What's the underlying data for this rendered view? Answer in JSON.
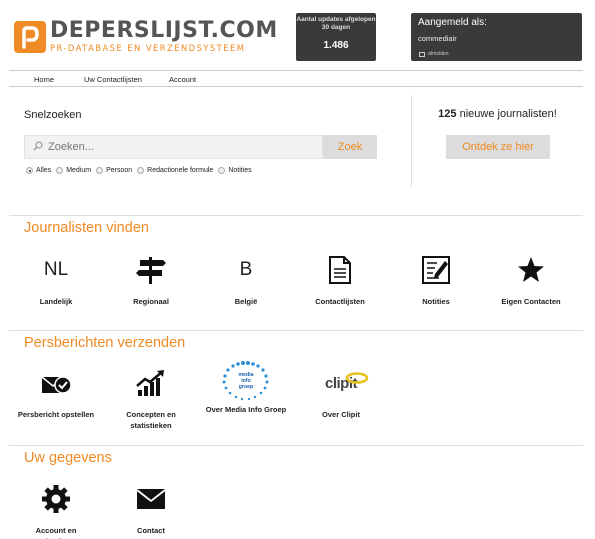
{
  "header": {
    "logo_name": "DEPERSLIJST.COM",
    "logo_sub": "PR-DATABASE EN VERZENDSYSTEEM",
    "updates_title": "Aantal updates afgelopen 30 dagen",
    "updates_count": "1.486",
    "login_title": "Aangemeld als:",
    "login_user": "commediair",
    "logout_label": "afmelden"
  },
  "nav": [
    "Home",
    "Uw Contactlijsten",
    "Account"
  ],
  "quick_search": {
    "title": "Snelzoeken",
    "placeholder": "Zoeken...",
    "button": "Zoek",
    "options": [
      "Alles",
      "Medium",
      "Persoon",
      "Redactionele formule",
      "Notities"
    ],
    "selected": "Alles"
  },
  "new_journalists": {
    "count": "125",
    "text": " nieuwe journalisten!",
    "button": "Ontdek ze hier"
  },
  "sections": {
    "find": {
      "title": "Journalisten vinden",
      "tiles": [
        "Landelijk",
        "Regionaal",
        "België",
        "Contactlijsten",
        "Notities",
        "Eigen Contacten"
      ],
      "nl_glyph": "NL",
      "b_glyph": "B"
    },
    "press": {
      "title": "Persberichten verzenden",
      "tiles": [
        "Persbericht opstellen",
        "Concepten en statistieken",
        "Over Media Info Groep",
        "Over Clipit"
      ],
      "mig_logo": "media info groep",
      "clipit_logo": "clipit"
    },
    "data": {
      "title": "Uw gegevens",
      "tiles": [
        "Account en gebruikers",
        "Contact"
      ]
    }
  },
  "colors": {
    "accent": "#f08a24",
    "dark_box": "#3a3a3a",
    "button_bg": "#dcdcdc"
  },
  "icons": [
    "search-icon",
    "signpost-icon",
    "document-icon",
    "notepad-icon",
    "star-icon",
    "envelope-check-icon",
    "chart-growth-icon",
    "gear-icon",
    "envelope-icon"
  ]
}
